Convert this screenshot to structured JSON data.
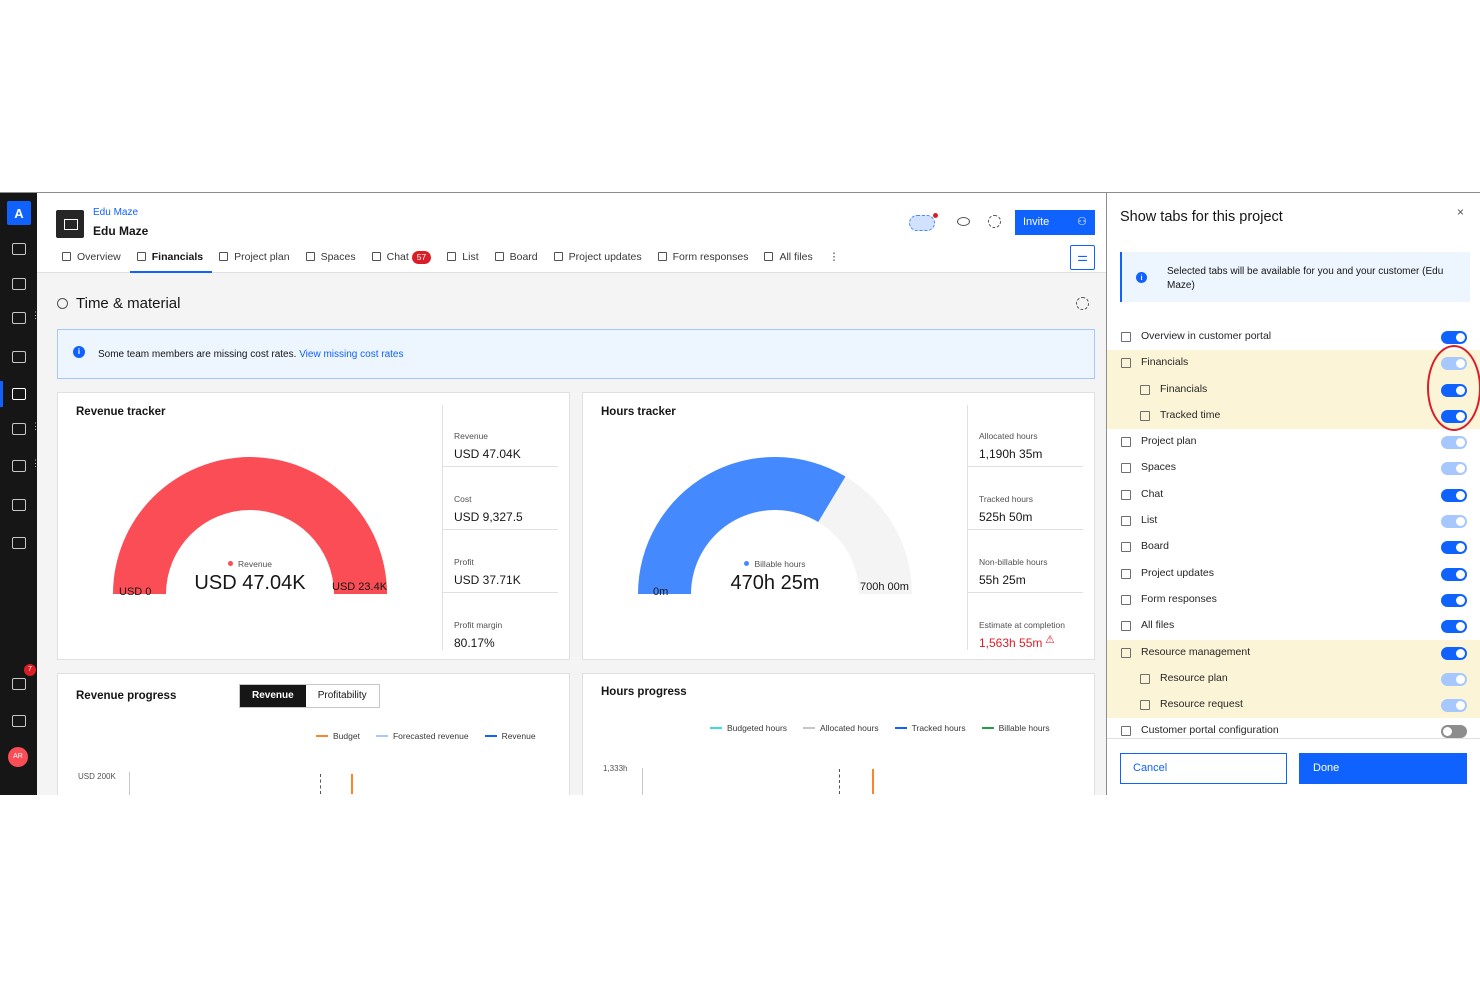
{
  "rail": {
    "logo": "A",
    "notif_badge": "7",
    "avatar": "AR"
  },
  "header": {
    "breadcrumb": "Edu Maze",
    "title": "Edu Maze",
    "invite_label": "Invite"
  },
  "tabs": [
    {
      "label": "Overview",
      "icon": "overview-icon"
    },
    {
      "label": "Financials",
      "icon": "financials-icon",
      "active": true
    },
    {
      "label": "Project plan",
      "icon": "project-plan-icon"
    },
    {
      "label": "Spaces",
      "icon": "spaces-icon"
    },
    {
      "label": "Chat",
      "icon": "chat-icon",
      "badge": "57"
    },
    {
      "label": "List",
      "icon": "list-icon"
    },
    {
      "label": "Board",
      "icon": "board-icon"
    },
    {
      "label": "Project updates",
      "icon": "project-updates-icon"
    },
    {
      "label": "Form responses",
      "icon": "form-responses-icon"
    },
    {
      "label": "All files",
      "icon": "all-files-icon"
    }
  ],
  "section": {
    "title": "Time & material"
  },
  "notice": {
    "text": "Some team members are missing cost rates. ",
    "link": "View missing cost rates"
  },
  "revenue_tracker": {
    "title": "Revenue tracker",
    "gauge_fraction": 1.0,
    "min_label": "USD 0",
    "max_label": "USD 23.4K",
    "center_value": "USD 47.04K",
    "center_legend": "Revenue",
    "color": "#fa4d56",
    "stats": [
      {
        "label": "Revenue",
        "value": "USD 47.04K"
      },
      {
        "label": "Cost",
        "value": "USD 9,327.5"
      },
      {
        "label": "Profit",
        "value": "USD 37.71K"
      },
      {
        "label": "Profit margin",
        "value": "80.17%"
      }
    ]
  },
  "hours_tracker": {
    "title": "Hours tracker",
    "gauge_fraction": 0.672,
    "min_label": "0m",
    "max_label": "700h 00m",
    "center_value": "470h 25m",
    "center_legend": "Billable hours",
    "color": "#4589ff",
    "stats": [
      {
        "label": "Allocated hours",
        "value": "1,190h 35m"
      },
      {
        "label": "Tracked hours",
        "value": "525h 50m"
      },
      {
        "label": "Non-billable hours",
        "value": "55h 25m"
      },
      {
        "label": "Estimate at completion",
        "value": "1,563h 55m",
        "warn": true
      }
    ]
  },
  "revenue_progress": {
    "title": "Revenue progress",
    "toggle": [
      "Revenue",
      "Profitability"
    ],
    "legend": [
      "Budget",
      "Forecasted revenue",
      "Revenue"
    ],
    "y_label": "USD 200K"
  },
  "hours_progress": {
    "title": "Hours progress",
    "legend": [
      "Budgeted hours",
      "Allocated hours",
      "Tracked hours",
      "Billable hours"
    ],
    "y_label": "1,333h"
  },
  "panel": {
    "title": "Show tabs for this project",
    "info": "Selected tabs will be available for you and your customer (Edu Maze)",
    "rows": [
      {
        "label": "Overview in customer portal",
        "state": "on",
        "indent": false,
        "hl": false
      },
      {
        "label": "Financials",
        "state": "disabled",
        "indent": false,
        "hl": true
      },
      {
        "label": "Financials",
        "state": "on",
        "indent": true,
        "hl": true
      },
      {
        "label": "Tracked time",
        "state": "on",
        "indent": true,
        "hl": true
      },
      {
        "label": "Project plan",
        "state": "disabled",
        "indent": false,
        "hl": false
      },
      {
        "label": "Spaces",
        "state": "disabled",
        "indent": false,
        "hl": false
      },
      {
        "label": "Chat",
        "state": "on",
        "indent": false,
        "hl": false
      },
      {
        "label": "List",
        "state": "disabled",
        "indent": false,
        "hl": false
      },
      {
        "label": "Board",
        "state": "on",
        "indent": false,
        "hl": false
      },
      {
        "label": "Project updates",
        "state": "on",
        "indent": false,
        "hl": false
      },
      {
        "label": "Form responses",
        "state": "on",
        "indent": false,
        "hl": false
      },
      {
        "label": "All files",
        "state": "on",
        "indent": false,
        "hl": false
      },
      {
        "label": "Resource management",
        "state": "on",
        "indent": false,
        "hl": true
      },
      {
        "label": "Resource plan",
        "state": "disabled",
        "indent": true,
        "hl": true
      },
      {
        "label": "Resource request",
        "state": "disabled",
        "indent": true,
        "hl": true
      },
      {
        "label": "Customer portal configuration",
        "state": "off",
        "indent": false,
        "hl": false
      }
    ],
    "cancel_label": "Cancel",
    "done_label": "Done"
  }
}
